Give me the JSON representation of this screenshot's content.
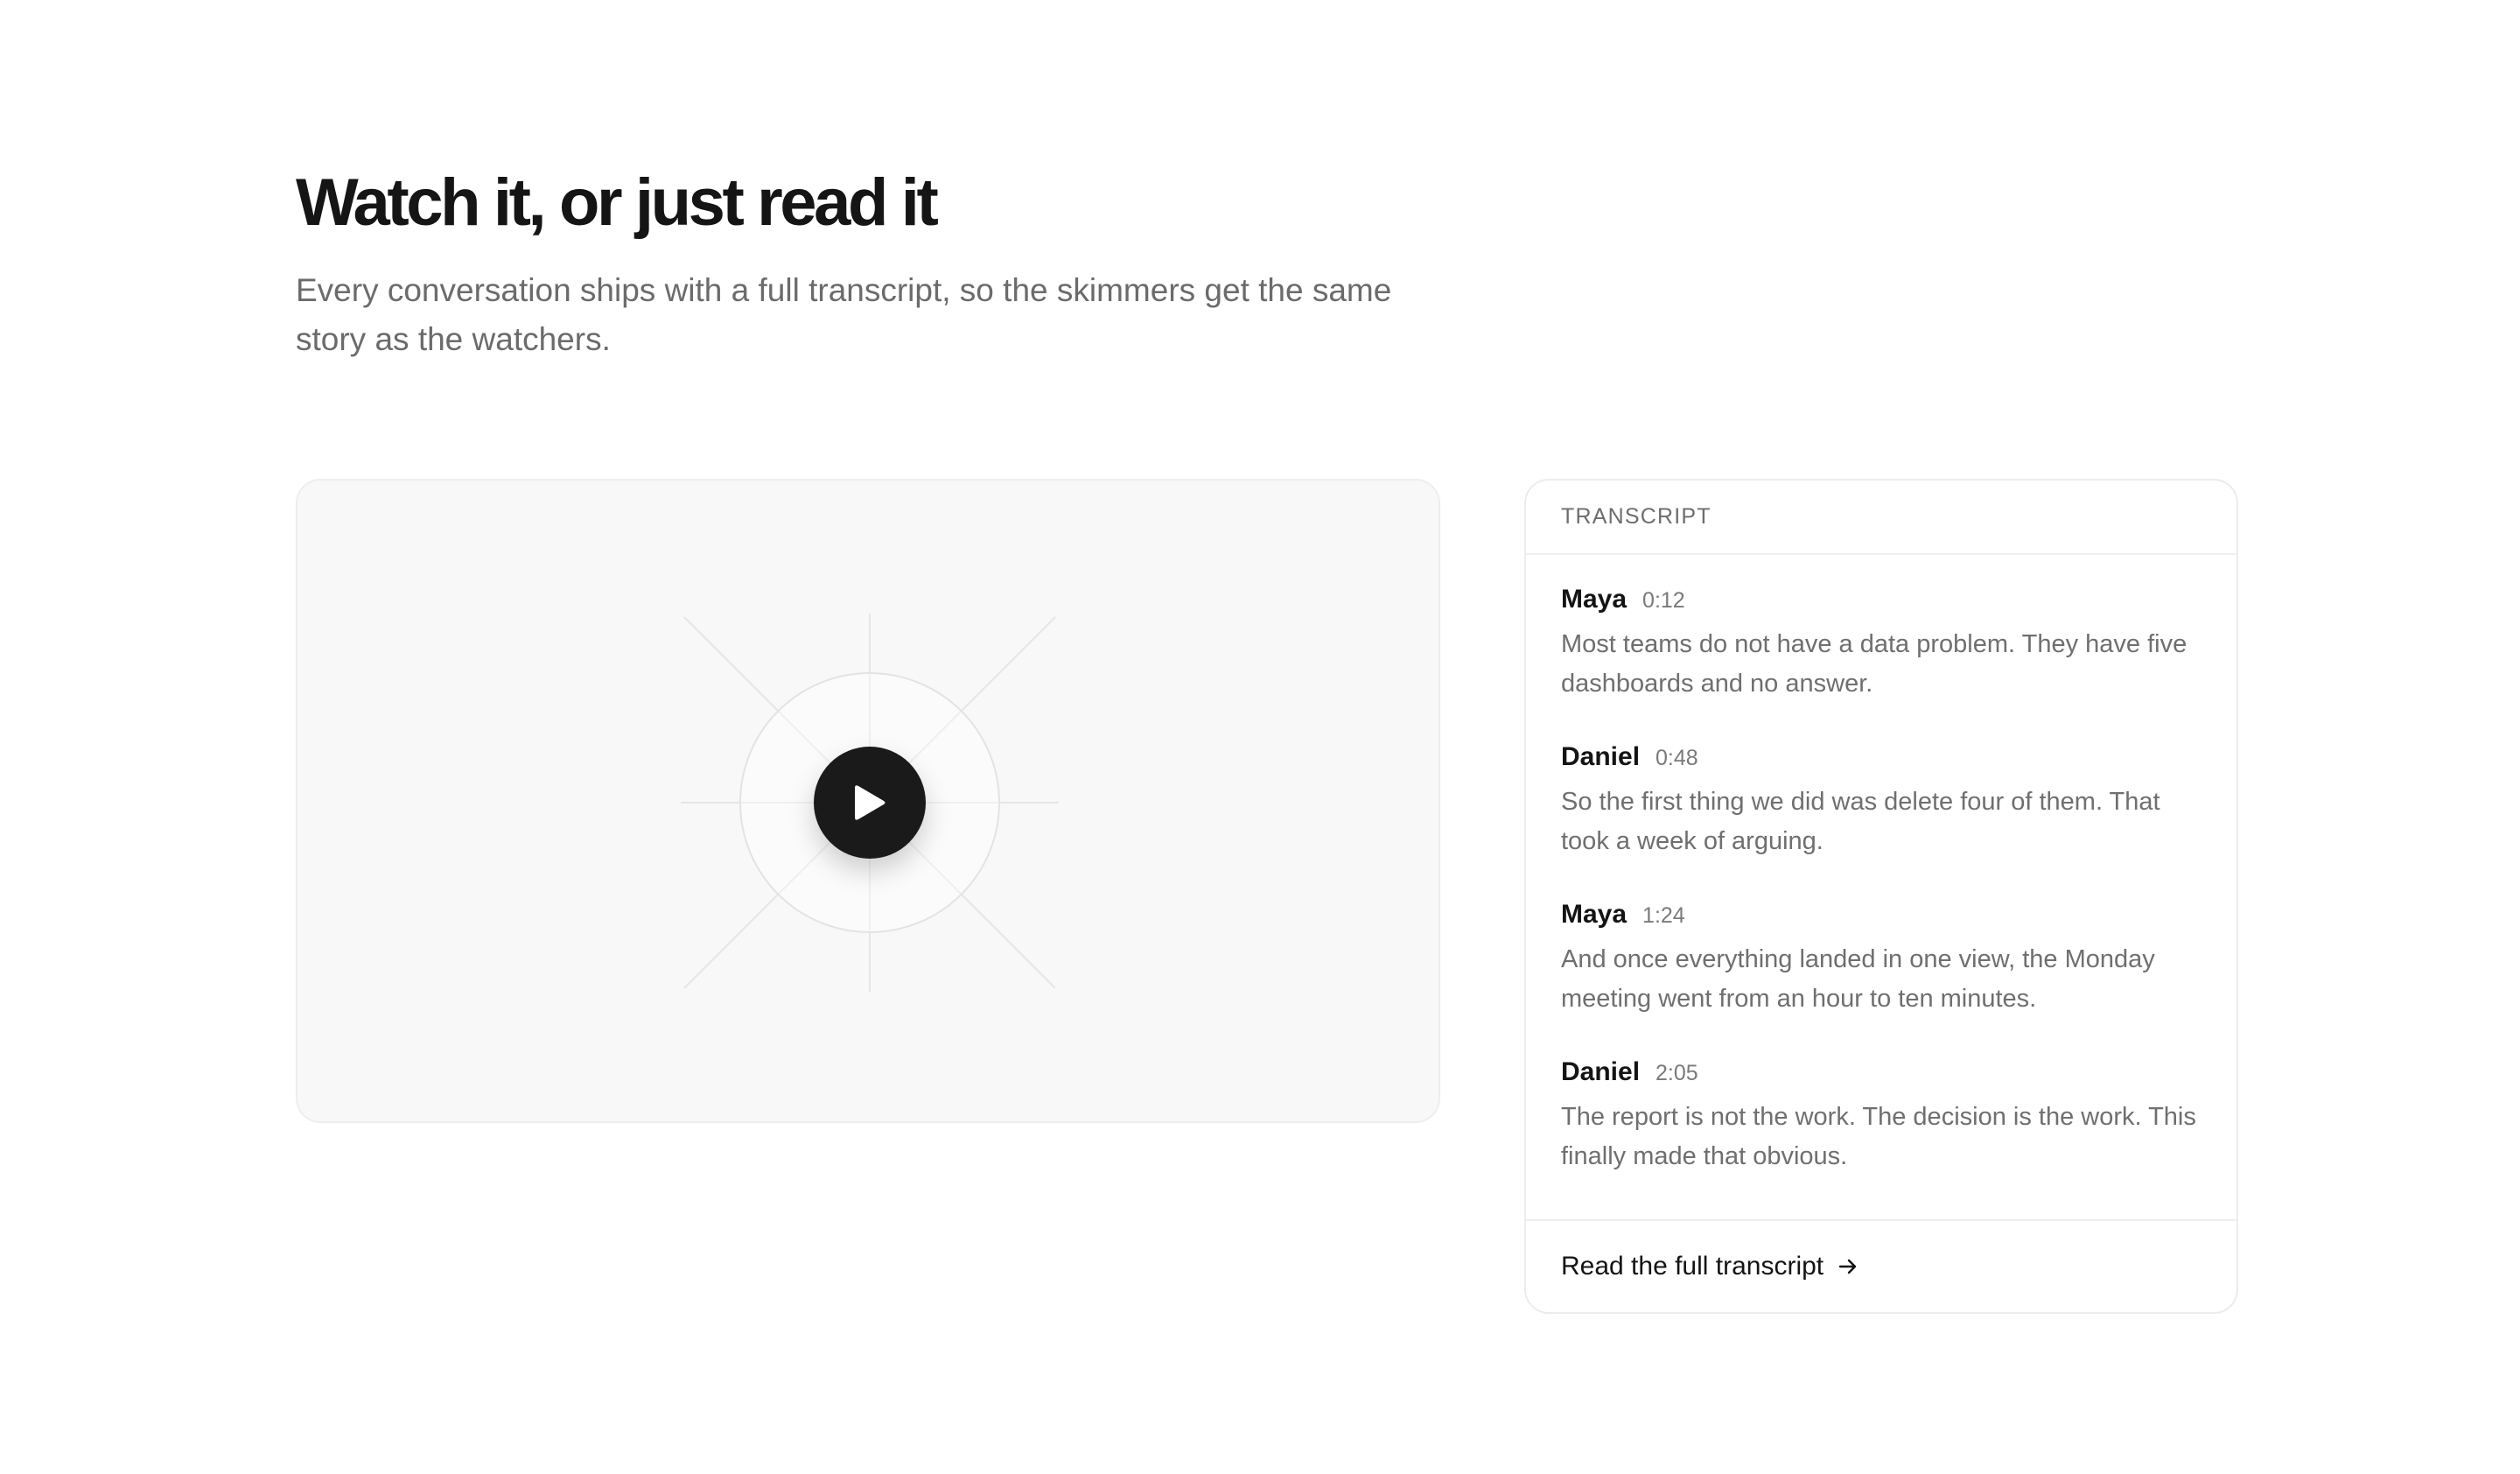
{
  "section": {
    "title": "Watch it, or just read it",
    "subtitle": "Every conversation ships with a full transcript, so the skimmers get the same story as the watchers."
  },
  "video": {
    "play_icon": "play-icon"
  },
  "transcript": {
    "label": "TRANSCRIPT",
    "entries": [
      {
        "speaker": "Maya",
        "time": "0:12",
        "text": "Most teams do not have a data problem. They have five dashboards and no answer."
      },
      {
        "speaker": "Daniel",
        "time": "0:48",
        "text": "So the first thing we did was delete four of them. That took a week of arguing."
      },
      {
        "speaker": "Maya",
        "time": "1:24",
        "text": "And once everything landed in one view, the Monday meeting went from an hour to ten minutes."
      },
      {
        "speaker": "Daniel",
        "time": "2:05",
        "text": "The report is not the work. The decision is the work. This finally made that obvious."
      }
    ],
    "footer_link": "Read the full transcript",
    "footer_icon": "arrow-right-icon"
  },
  "colors": {
    "text_primary": "#151515",
    "text_secondary": "#6b6b6b",
    "video_bg": "#f8f8f8",
    "play_button": "#1a1a1a"
  }
}
